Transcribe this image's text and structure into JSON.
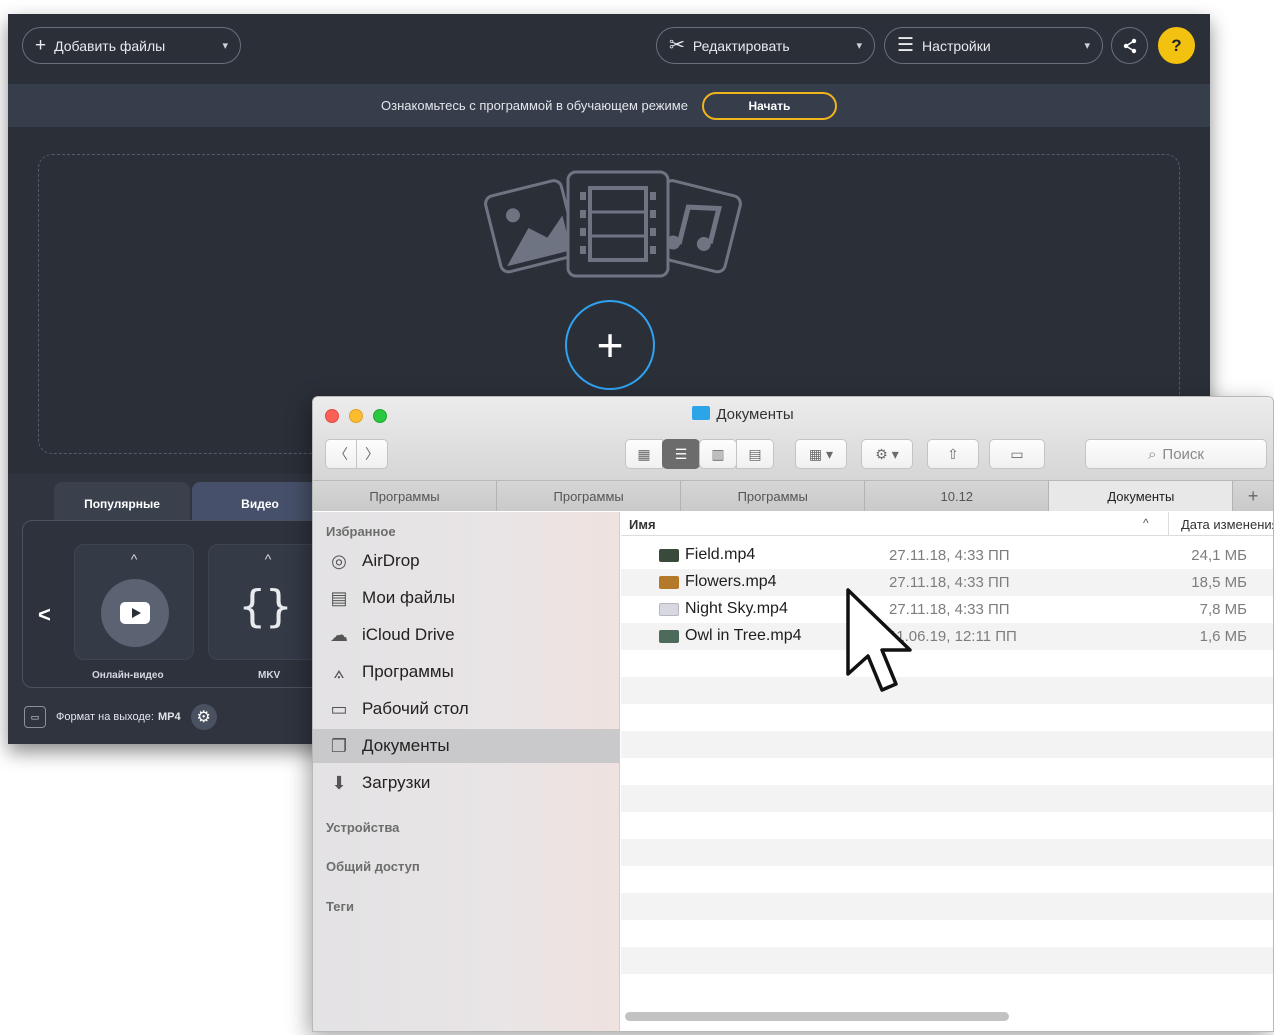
{
  "converter": {
    "add_files": "Добавить файлы",
    "edit": "Редактировать",
    "settings": "Настройки",
    "help": "?",
    "banner_text": "Ознакомьтесь с программой в обучающем режиме",
    "start_button": "Начать",
    "add_symbol": "+",
    "tabs": [
      "Популярные",
      "Видео"
    ],
    "formats": [
      {
        "label": "Онлайн-видео",
        "icon": "play-icon"
      },
      {
        "label": "MKV",
        "icon": "braces-icon"
      }
    ],
    "prev_arrow": "<",
    "output_label": "Формат на выходе:",
    "output_value": "MP4"
  },
  "finder": {
    "title": "Документы",
    "search_placeholder": "Поиск",
    "tabs": [
      "Программы",
      "Программы",
      "Программы",
      "10.12",
      "Документы"
    ],
    "tab_add": "+",
    "sidebar": {
      "favorites_header": "Избранное",
      "items": [
        {
          "label": "AirDrop",
          "icon": "airdrop-icon"
        },
        {
          "label": "Мои файлы",
          "icon": "all-files-icon"
        },
        {
          "label": "iCloud Drive",
          "icon": "cloud-icon"
        },
        {
          "label": "Программы",
          "icon": "applications-icon"
        },
        {
          "label": "Рабочий стол",
          "icon": "desktop-icon"
        },
        {
          "label": "Документы",
          "icon": "documents-icon",
          "selected": true
        },
        {
          "label": "Загрузки",
          "icon": "downloads-icon"
        }
      ],
      "devices_header": "Устройства",
      "shared_header": "Общий доступ",
      "tags_header": "Теги"
    },
    "columns": {
      "name": "Имя",
      "date": "Дата изменения"
    },
    "files": [
      {
        "name": "Field.mp4",
        "date": "27.11.18, 4:33 ПП",
        "size": "24,1 МБ",
        "thumb": "#3a4a3a"
      },
      {
        "name": "Flowers.mp4",
        "date": "27.11.18, 4:33 ПП",
        "size": "18,5 МБ",
        "thumb": "#b5792a"
      },
      {
        "name": "Night Sky.mp4",
        "date": "27.11.18, 4:33 ПП",
        "size": "7,8 МБ",
        "thumb": "#d8d8e0"
      },
      {
        "name": "Owl in Tree.mp4",
        "date": "11.06.19, 12:11 ПП",
        "size": "1,6 МБ",
        "thumb": "#4c6b5a"
      }
    ]
  }
}
